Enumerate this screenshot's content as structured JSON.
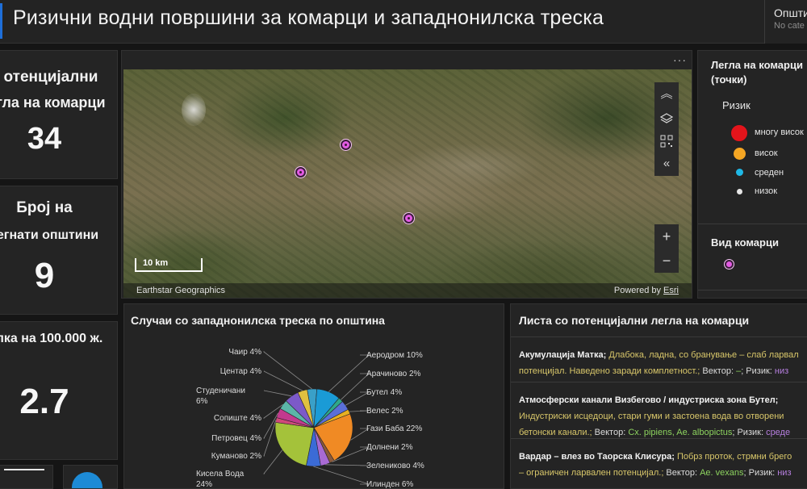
{
  "header": {
    "title": "Ризични водни површини за комарци и западнонилска треска",
    "selector_label": "Општи",
    "selector_value": "No cate"
  },
  "kpis": [
    {
      "title_line1": "отенцијални",
      "title_line2": "гла на комарци",
      "value": "34"
    },
    {
      "title_line1": "Број на",
      "title_line2": "егнати општини",
      "value": "9"
    },
    {
      "title_line1": "лка на 100.000 ж.",
      "title_line2": "",
      "value": "2.7"
    }
  ],
  "map": {
    "scale_label": "10 km",
    "attribution_left": "Earthstar Geographics",
    "attribution_right_prefix": "Powered by ",
    "attribution_right_link": "Esri",
    "more_menu": "···",
    "buttons": {
      "collapse": "︽",
      "zoom_in": "+",
      "zoom_out": "−",
      "expand_left": "«"
    }
  },
  "legend": {
    "layer1_title_line1": "Легла на комарци",
    "layer1_title_line2": "(точки)",
    "risk_label": "Ризик",
    "items": [
      {
        "label": "многу висок",
        "color": "#e3141b"
      },
      {
        "label": "висок",
        "color": "#f5a623"
      },
      {
        "label": "среден",
        "color": "#1fb8e6"
      },
      {
        "label": "низок",
        "color": "#e6e6e6"
      }
    ],
    "layer2_title": "Вид комарци",
    "species_color": "#e35be3"
  },
  "pie_panel": {
    "title": "Случаи со западнонилска треска по општина"
  },
  "chart_data": {
    "type": "pie",
    "title": "Случаи со западнонилска треска по општина",
    "slices": [
      {
        "label": "Аеродром",
        "value": 10,
        "display": "Аеродром 10%",
        "color": "#1a9bd6"
      },
      {
        "label": "Арачиново",
        "value": 2,
        "display": "Арачиново 2%",
        "color": "#2fa88a"
      },
      {
        "label": "Бутел",
        "value": 4,
        "display": "Бутел 4%",
        "color": "#5a6fd8"
      },
      {
        "label": "Велес",
        "value": 2,
        "display": "Велес 2%",
        "color": "#e8b021"
      },
      {
        "label": "Гази Баба",
        "value": 22,
        "display": "Гази Баба 22%",
        "color": "#f08a24"
      },
      {
        "label": "Долнени",
        "value": 2,
        "display": "Долнени 2%",
        "color": "#8a5a3c"
      },
      {
        "label": "Зелениково",
        "value": 4,
        "display": "Зелениково 4%",
        "color": "#a86ad4"
      },
      {
        "label": "Илинден",
        "value": 6,
        "display": "Илинден 6%",
        "color": "#3b6bd6"
      },
      {
        "label": "Кисела Вода",
        "value": 24,
        "display": "Кисела Вода 24%",
        "color": "#a4c23a"
      },
      {
        "label": "Куманово",
        "value": 2,
        "display": "Куманово 2%",
        "color": "#d04a7a"
      },
      {
        "label": "Петровец",
        "value": 4,
        "display": "Петровец 4%",
        "color": "#c23a8e"
      },
      {
        "label": "Сопиште",
        "value": 4,
        "display": "Сопиште 4%",
        "color": "#5bb5a8"
      },
      {
        "label": "Студеничани",
        "value": 6,
        "display": "Студеничани 6%",
        "color": "#7c5ac8"
      },
      {
        "label": "Центар",
        "value": 4,
        "display": "Центар 4%",
        "color": "#e0c040"
      },
      {
        "label": "Чаир",
        "value": 4,
        "display": "Чаир 4%",
        "color": "#3aa0c8"
      }
    ]
  },
  "list_panel": {
    "title": "Листа со потенцијални легла на комарци",
    "items": [
      {
        "name": "Акумулација Матка;",
        "desc1": " Длабока, ладна, со бранување – слаб ларвал",
        "desc2": "потенцијал. Наведено заради комплетност.;",
        "vector_label": " Вектор: ",
        "vector": "–",
        "risk_label": "; Ризик: ",
        "risk": "низ"
      },
      {
        "name": "Атмосферски канали Визбегово / индустриска зона Бутел;",
        "desc1": "Индустриски исцедоци, стари гуми и застоена вода во отворени",
        "desc2": "бетонски канали.;",
        "vector_label": " Вектор: ",
        "vector": "Cx. pipiens, Ae. albopictus",
        "risk_label": "; Ризик: ",
        "risk": "средe"
      },
      {
        "name": "Вардар – влез во Таорска Клисура;",
        "desc1": " Побрз проток, стрмни брего",
        "desc2": "– ограничен ларвален потенцијал.;",
        "vector_label": " Вектор: ",
        "vector": "Ae. vexans",
        "risk_label": "; Ризик: ",
        "risk": "низ"
      }
    ]
  }
}
